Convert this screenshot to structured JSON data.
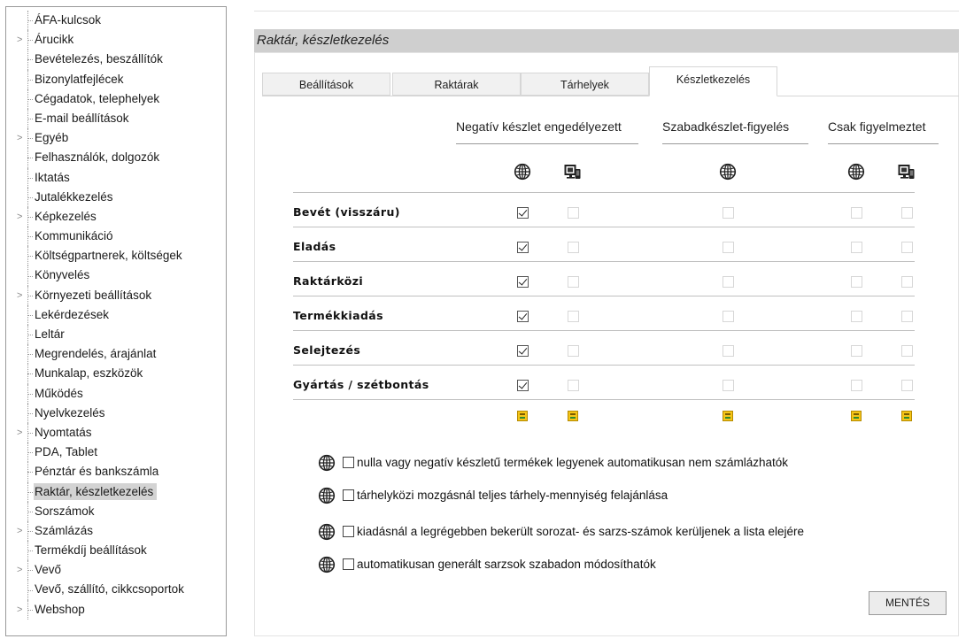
{
  "sidebar": {
    "items": [
      {
        "label": "ÁFA-kulcsok",
        "expandable": false
      },
      {
        "label": "Árucikk",
        "expandable": true
      },
      {
        "label": "Bevételezés, beszállítók",
        "expandable": false
      },
      {
        "label": "Bizonylatfejlécek",
        "expandable": false
      },
      {
        "label": "Cégadatok, telephelyek",
        "expandable": false
      },
      {
        "label": "E-mail beállítások",
        "expandable": false
      },
      {
        "label": "Egyéb",
        "expandable": true
      },
      {
        "label": "Felhasználók, dolgozók",
        "expandable": false
      },
      {
        "label": "Iktatás",
        "expandable": false
      },
      {
        "label": "Jutalékkezelés",
        "expandable": false
      },
      {
        "label": "Képkezelés",
        "expandable": true
      },
      {
        "label": "Kommunikáció",
        "expandable": false
      },
      {
        "label": "Költségpartnerek, költségek",
        "expandable": false
      },
      {
        "label": "Könyvelés",
        "expandable": false
      },
      {
        "label": "Környezeti beállítások",
        "expandable": true
      },
      {
        "label": "Lekérdezések",
        "expandable": false
      },
      {
        "label": "Leltár",
        "expandable": false
      },
      {
        "label": "Megrendelés, árajánlat",
        "expandable": false
      },
      {
        "label": "Munkalap, eszközök",
        "expandable": false
      },
      {
        "label": "Működés",
        "expandable": false
      },
      {
        "label": "Nyelvkezelés",
        "expandable": false
      },
      {
        "label": "Nyomtatás",
        "expandable": true
      },
      {
        "label": "PDA, Tablet",
        "expandable": false
      },
      {
        "label": "Pénztár és bankszámla",
        "expandable": false
      },
      {
        "label": "Raktár, készletkezelés",
        "expandable": false,
        "selected": true
      },
      {
        "label": "Sorszámok",
        "expandable": false
      },
      {
        "label": "Számlázás",
        "expandable": true
      },
      {
        "label": "Termékdíj beállítások",
        "expandable": false
      },
      {
        "label": "Vevő",
        "expandable": true
      },
      {
        "label": "Vevő, szállító, cikkcsoportok",
        "expandable": false
      },
      {
        "label": "Webshop",
        "expandable": true
      }
    ]
  },
  "header": {
    "title": "Raktár, készletkezelés"
  },
  "tabs": [
    {
      "label": "Beállítások",
      "active": false
    },
    {
      "label": "Raktárak",
      "active": false
    },
    {
      "label": "Tárhelyek",
      "active": false
    },
    {
      "label": "Készletkezelés",
      "active": true
    }
  ],
  "groups": [
    {
      "label": "Negatív készlet engedélyezett"
    },
    {
      "label": "Szabadkészlet-figyelés"
    },
    {
      "label": "Csak figyelmeztet"
    }
  ],
  "rows": [
    {
      "label": "Bevét (visszáru)",
      "checks": [
        true,
        false,
        false,
        false,
        false
      ]
    },
    {
      "label": "Eladás",
      "checks": [
        true,
        false,
        false,
        false,
        false
      ]
    },
    {
      "label": "Raktárközi",
      "checks": [
        true,
        false,
        false,
        false,
        false
      ]
    },
    {
      "label": "Termékkiadás",
      "checks": [
        true,
        false,
        false,
        false,
        false
      ]
    },
    {
      "label": "Selejtezés",
      "checks": [
        true,
        false,
        false,
        false,
        false
      ]
    },
    {
      "label": "Gyártás / szétbontás",
      "checks": [
        true,
        false,
        false,
        false,
        false
      ]
    }
  ],
  "options": [
    {
      "label": "nulla vagy negatív készletű termékek legyenek automatikusan nem számlázhatók",
      "checked": false
    },
    {
      "label": "tárhelyközi mozgásnál teljes tárhely-mennyiség felajánlása",
      "checked": false
    },
    {
      "label": "kiadásnál a legrégebben bekerült sorozat- és sarzs-számok kerüljenek a lista elejére",
      "checked": false
    },
    {
      "label": "automatikusan generált sarzsok szabadon módosíthatók",
      "checked": false
    }
  ],
  "save_label": "MENTÉS",
  "icons": {
    "global": "globe-icon",
    "device": "device-icon",
    "select-all": "select-all-icon"
  }
}
